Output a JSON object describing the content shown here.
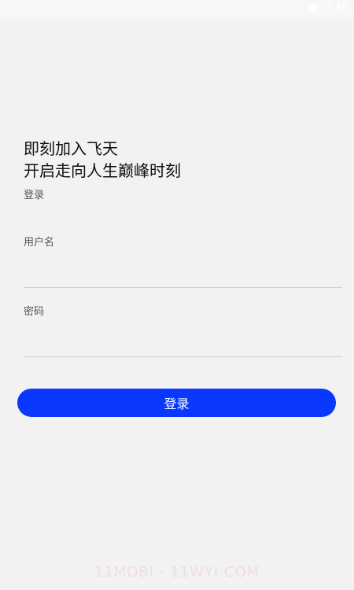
{
  "status_bar": {
    "time": "7:38",
    "wifi_icon": "wifi-icon"
  },
  "headline": {
    "line1": "即刻加入飞天",
    "line2": "开启走向人生巅峰时刻"
  },
  "sub_label": "登录",
  "form": {
    "username_label": "用户名",
    "username_value": "",
    "password_label": "密码",
    "password_value": ""
  },
  "login_button": "登录",
  "watermark": "11MOBI · 11WYI.COM",
  "colors": {
    "primary": "#0a38ff",
    "background": "#f2f2f2"
  }
}
